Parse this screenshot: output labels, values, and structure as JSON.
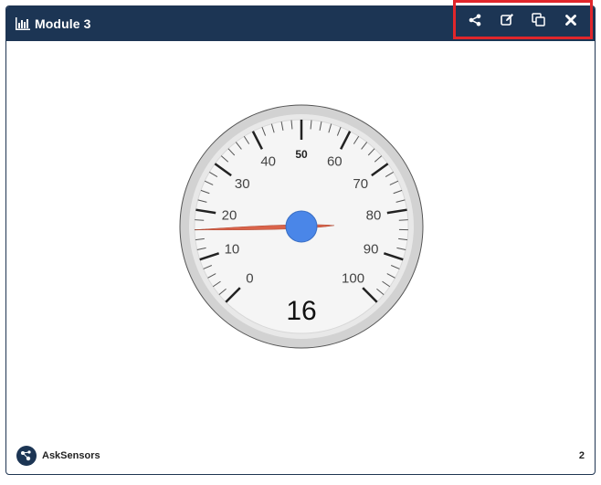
{
  "module": {
    "title": "Module 3",
    "title_icon": "bar-chart-icon"
  },
  "toolbar": {
    "share_icon": "share-icon",
    "edit_icon": "edit-icon",
    "duplicate_icon": "duplicate-icon",
    "close_icon": "close-icon",
    "highlight_color": "#e0262b"
  },
  "gauge": {
    "value": 16,
    "value_text": "16",
    "min": 0,
    "max": 100,
    "tick_labels": [
      "0",
      "10",
      "20",
      "30",
      "40",
      "50",
      "60",
      "70",
      "80",
      "90",
      "100"
    ],
    "needle_color": "#d9634a",
    "hub_color": "#4a86e8"
  },
  "footer": {
    "brand": "AskSensors",
    "logo_icon": "asksensors-logo-icon",
    "page": "2"
  },
  "colors": {
    "header": "#1c3554"
  }
}
